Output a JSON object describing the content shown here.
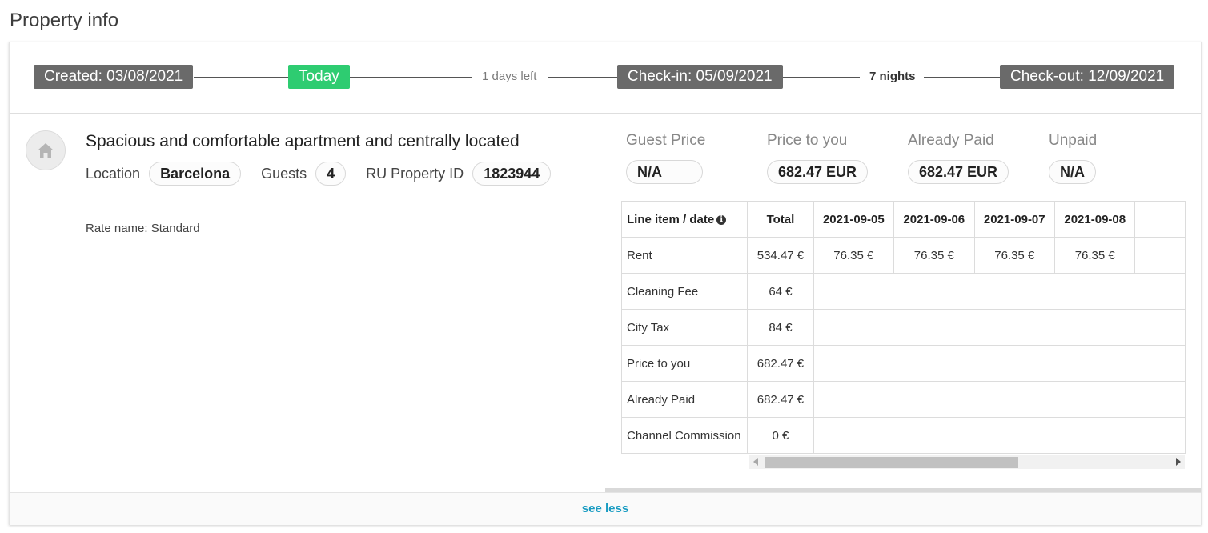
{
  "page_title": "Property info",
  "timeline": {
    "created": "Created: 03/08/2021",
    "today": "Today",
    "days_left": "1 days left",
    "checkin": "Check-in: 05/09/2021",
    "nights": "7 nights",
    "checkout": "Check-out: 12/09/2021",
    "today_color": "#2ecc71",
    "badge_color": "#6a6a6a"
  },
  "property": {
    "icon": "home-icon",
    "title": "Spacious and comfortable apartment and centrally located",
    "location_label": "Location",
    "location_value": "Barcelona",
    "guests_label": "Guests",
    "guests_value": "4",
    "ru_id_label": "RU Property ID",
    "ru_id_value": "1823944",
    "rate_name": "Rate name: Standard"
  },
  "prices": {
    "guest_price_label": "Guest Price",
    "guest_price_value": "N/A",
    "price_to_you_label": "Price to you",
    "price_to_you_value": "682.47 EUR",
    "already_paid_label": "Already Paid",
    "already_paid_value": "682.47 EUR",
    "unpaid_label": "Unpaid",
    "unpaid_value": "N/A"
  },
  "table": {
    "headers": [
      "Line item / date",
      "Total",
      "2021-09-05",
      "2021-09-06",
      "2021-09-07",
      "2021-09-08"
    ],
    "rows": [
      {
        "label": "Rent",
        "total": "534.47 €",
        "days": [
          "76.35 €",
          "76.35 €",
          "76.35 €",
          "76.35 €"
        ]
      },
      {
        "label": "Cleaning Fee",
        "total": "64 €"
      },
      {
        "label": "City Tax",
        "total": "84 €"
      },
      {
        "label": "Price to you",
        "total": "682.47 €"
      },
      {
        "label": "Already Paid",
        "total": "682.47 €"
      },
      {
        "label": "Channel Commission",
        "total": "0 €"
      }
    ]
  },
  "footer": {
    "see_less": "see less",
    "link_color": "#1a9cc2"
  }
}
